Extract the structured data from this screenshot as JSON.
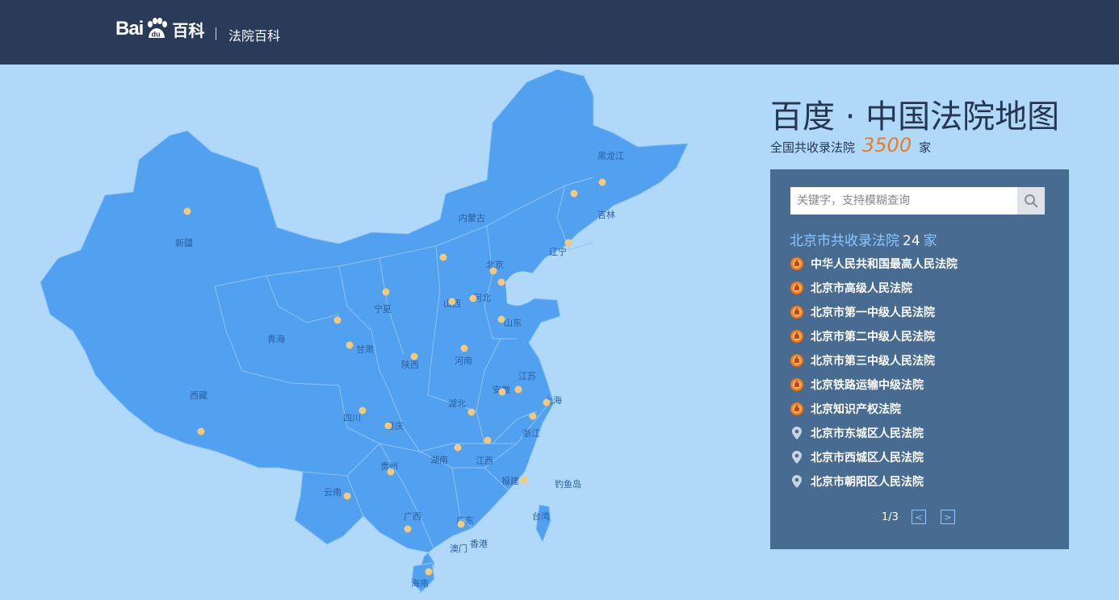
{
  "header": {
    "logo_bai": "Bai",
    "logo_du": "du",
    "logo_baike": "百科",
    "subtitle": "法院百科"
  },
  "map": {
    "provinces": [
      "黑龙江",
      "吉林",
      "辽宁",
      "内蒙古",
      "新疆",
      "青海",
      "西藏",
      "甘肃",
      "宁夏",
      "陕西",
      "山西",
      "北京",
      "河北",
      "山东",
      "河南",
      "江苏",
      "安徽",
      "湖北",
      "四川",
      "重庆",
      "贵州",
      "云南",
      "广西",
      "广东",
      "湖南",
      "江西",
      "福建",
      "浙江",
      "上海",
      "台湾",
      "海南",
      "香港",
      "澳门",
      "钓鱼岛"
    ]
  },
  "page": {
    "title": "百度 · 中国法院地图",
    "summary_prefix": "全国共收录法院",
    "summary_count": "3500",
    "summary_suffix": "家"
  },
  "panel": {
    "search_placeholder": "关键字，支持模糊查询",
    "list_title_prefix": "北京市共收录法院",
    "list_title_count": "24",
    "list_title_suffix": "家",
    "courts": [
      {
        "name": "中华人民共和国最高人民法院",
        "icon": "court-emblem-icon"
      },
      {
        "name": "北京市高级人民法院",
        "icon": "court-emblem-icon"
      },
      {
        "name": "北京市第一中级人民法院",
        "icon": "court-emblem-icon"
      },
      {
        "name": "北京市第二中级人民法院",
        "icon": "court-emblem-icon"
      },
      {
        "name": "北京市第三中级人民法院",
        "icon": "court-emblem-icon"
      },
      {
        "name": "北京铁路运输中级法院",
        "icon": "court-emblem-icon"
      },
      {
        "name": "北京知识产权法院",
        "icon": "court-emblem-icon"
      },
      {
        "name": "北京市东城区人民法院",
        "icon": "location-pin-icon"
      },
      {
        "name": "北京市西城区人民法院",
        "icon": "location-pin-icon"
      },
      {
        "name": "北京市朝阳区人民法院",
        "icon": "location-pin-icon"
      }
    ],
    "pager": {
      "page_text": "1/3",
      "prev": "<",
      "next": ">"
    }
  },
  "colors": {
    "header_bg": "#293b58",
    "page_bg": "#b0d8f8",
    "map_fill": "#52a0f0",
    "marker": "#f6c97a",
    "panel_bg": "#476b91",
    "accent_count": "#e87c27",
    "list_title": "#8ec7ff"
  }
}
